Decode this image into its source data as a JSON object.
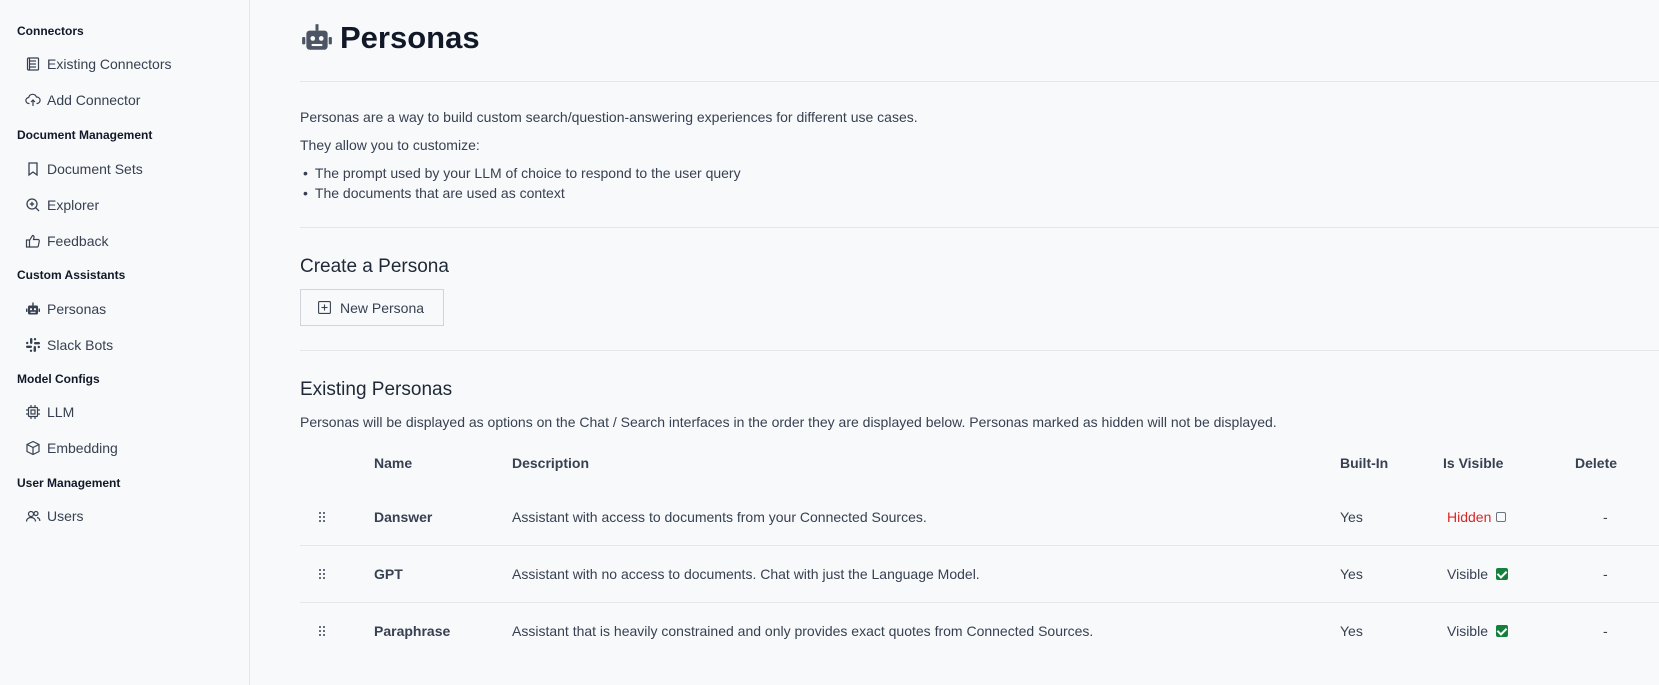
{
  "sidebar": {
    "sections": [
      {
        "title": "Connectors",
        "items": [
          {
            "label": "Existing Connectors",
            "icon": "list-icon"
          },
          {
            "label": "Add Connector",
            "icon": "cloud-upload-icon"
          }
        ]
      },
      {
        "title": "Document Management",
        "items": [
          {
            "label": "Document Sets",
            "icon": "bookmark-icon"
          },
          {
            "label": "Explorer",
            "icon": "zoom-in-icon"
          },
          {
            "label": "Feedback",
            "icon": "thumbs-up-icon"
          }
        ]
      },
      {
        "title": "Custom Assistants",
        "items": [
          {
            "label": "Personas",
            "icon": "robot-icon"
          },
          {
            "label": "Slack Bots",
            "icon": "slack-icon"
          }
        ]
      },
      {
        "title": "Model Configs",
        "items": [
          {
            "label": "LLM",
            "icon": "cpu-icon"
          },
          {
            "label": "Embedding",
            "icon": "cube-icon"
          }
        ]
      },
      {
        "title": "User Management",
        "items": [
          {
            "label": "Users",
            "icon": "users-icon"
          }
        ]
      }
    ]
  },
  "main": {
    "title": "Personas",
    "intro": "Personas are a way to build custom search/question-answering experiences for different use cases.",
    "customize_label": "They allow you to customize:",
    "bullets": [
      "The prompt used by your LLM of choice to respond to the user query",
      "The documents that are used as context"
    ],
    "create_heading": "Create a Persona",
    "new_button": "New Persona",
    "existing_heading": "Existing Personas",
    "existing_desc": "Personas will be displayed as options on the Chat / Search interfaces in the order they are displayed below. Personas marked as hidden will not be displayed.",
    "table": {
      "headers": [
        "Name",
        "Description",
        "Built-In",
        "Is Visible",
        "Delete"
      ],
      "rows": [
        {
          "name": "Danswer",
          "description": "Assistant with access to documents from your Connected Sources.",
          "built_in": "Yes",
          "visibility": "Hidden",
          "delete": "-"
        },
        {
          "name": "GPT",
          "description": "Assistant with no access to documents. Chat with just the Language Model.",
          "built_in": "Yes",
          "visibility": "Visible",
          "delete": "-"
        },
        {
          "name": "Paraphrase",
          "description": "Assistant that is heavily constrained and only provides exact quotes from Connected Sources.",
          "built_in": "Yes",
          "visibility": "Visible",
          "delete": "-"
        }
      ]
    }
  },
  "colors": {
    "hidden": "#dc2626",
    "visible_check": "#15803d"
  }
}
